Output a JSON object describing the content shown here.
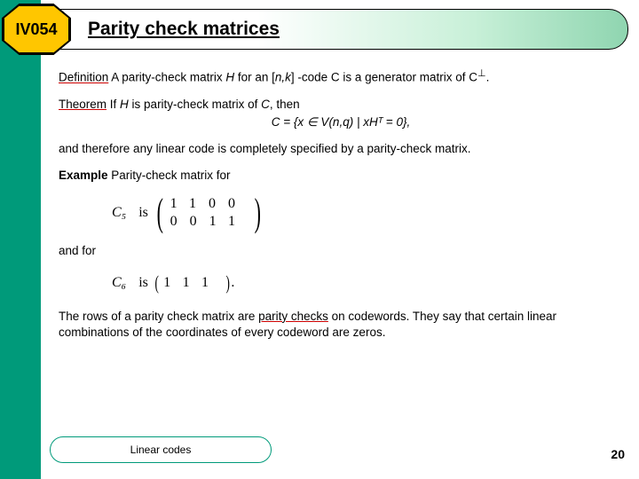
{
  "slide": {
    "course_code": "IV054",
    "title": "Parity check matrices",
    "footer_label": "Linear codes",
    "page_number": "20"
  },
  "body": {
    "definition_prefix": "Definition",
    "definition_text_1": " A parity-check matrix ",
    "definition_H": "H",
    "definition_text_2": " for an [",
    "definition_nk": "n,k",
    "definition_text_3": "] -code C is a generator matrix of C",
    "definition_perp": "⊥",
    "definition_end": ".",
    "theorem_prefix": "Theorem",
    "theorem_text_1": " If ",
    "theorem_H": "H",
    "theorem_text_2": " is parity-check matrix of ",
    "theorem_C": "C",
    "theorem_text_3": ", then",
    "theorem_eq": "C = {x ∈ V(n,q) | xHᵀ = 0},",
    "therefore": "and therefore any linear code is completely specified by a parity-check matrix.",
    "example_prefix": "Example",
    "example_text": " Parity-check matrix for",
    "matrix5_name": "C₅",
    "is_word": "is",
    "matrix5_row1": "1100",
    "matrix5_row2": "0011",
    "and_for": "and for",
    "matrix6_name": "C₆",
    "matrix6_row": "111",
    "matrix6_end": ".",
    "rows_text_1": "The rows of a parity check matrix are ",
    "rows_underlined": "parity checks",
    "rows_text_2": " on codewords. They say that certain linear combinations of the coordinates of every codeword are zeros."
  },
  "chart_data": {
    "type": "table",
    "matrices": [
      {
        "name": "C5",
        "rows": [
          [
            1,
            1,
            0,
            0
          ],
          [
            0,
            0,
            1,
            1
          ]
        ]
      },
      {
        "name": "C6",
        "rows": [
          [
            1,
            1,
            1
          ]
        ]
      }
    ]
  }
}
